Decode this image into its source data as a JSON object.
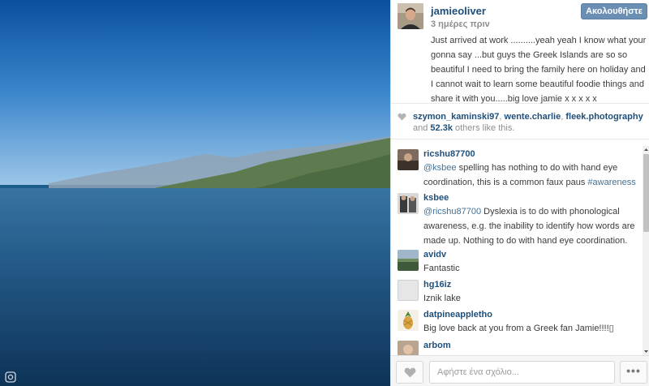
{
  "post": {
    "username": "jamieoliver",
    "time_ago": "3 ημέρες πριν",
    "follow_label": "Ακολουθήστε",
    "caption": "Just arrived at work ..........yeah yeah I know what your gonna say ...but guys the Greek Islands are so so beautiful I need to bring the family here on holiday and I cannot wait to learn some beautiful foodie things and share it with you.....big love jamie x x x x x"
  },
  "likes": {
    "user1": "szymon_kaminski97",
    "sep1": ", ",
    "user2": "wente.charlie",
    "sep2": ", ",
    "user3": "fleek.photography",
    "and": "and ",
    "count": "52.3k",
    "suffix": " others like this."
  },
  "comments": [
    {
      "user": "ricshu87700",
      "mention": "@ksbee",
      "text": " spelling has nothing to do with hand eye coordination, this is a common faux paus ",
      "hashtag": "#awareness"
    },
    {
      "user": "ksbee",
      "mention": "@ricshu87700",
      "text": " Dyslexia is to do with phonological awareness, e.g. the inability to identify how words are made up. Nothing to do with hand eye coordination."
    },
    {
      "user": "avidv",
      "text": "Fantastic"
    },
    {
      "user": "hg16iz",
      "text": "Iznik lake"
    },
    {
      "user": "datpineappletho",
      "text": "Big love back at you from a Greek fan Jamie!!!!▯"
    },
    {
      "user": "arbom",
      "text": ""
    }
  ],
  "footer": {
    "comment_placeholder": "Αφήστε ένα σχόλιο...",
    "more_label": "•••"
  },
  "colors": {
    "link": "#1e4f7b",
    "follow_button": "#6b8eb3"
  },
  "icons": {
    "like": "heart-icon",
    "more": "ellipsis-icon",
    "photo_logo": "instagram-icon"
  }
}
